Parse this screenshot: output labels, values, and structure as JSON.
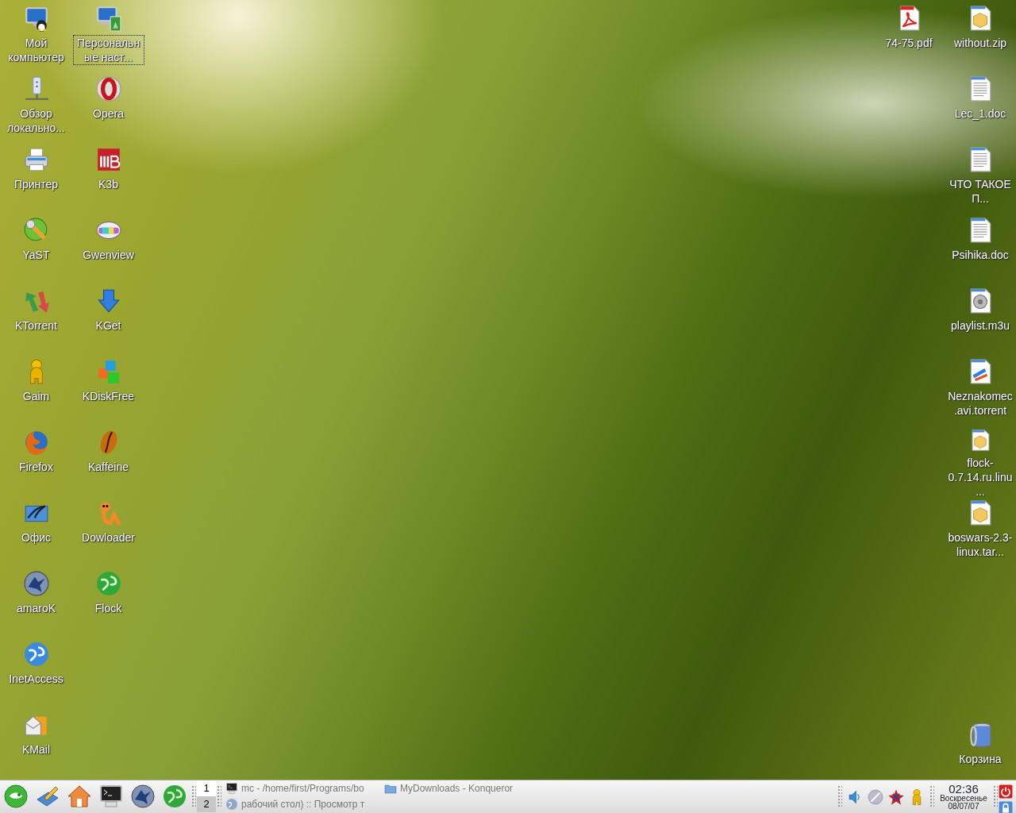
{
  "desktop": {
    "left_columns": [
      {
        "icons": [
          {
            "kind": "computer",
            "label": "Мой компьютер",
            "selected": false
          },
          {
            "kind": "network",
            "label": "Обзор локально...",
            "selected": false
          },
          {
            "kind": "printer",
            "label": "Принтер",
            "selected": false
          },
          {
            "kind": "wrench",
            "label": "YaST",
            "selected": false
          },
          {
            "kind": "arrows",
            "label": "KTorrent",
            "selected": false
          },
          {
            "kind": "person",
            "label": "Gaim",
            "selected": false
          },
          {
            "kind": "fox",
            "label": "Firefox",
            "selected": false
          },
          {
            "kind": "birds",
            "label": "Офис",
            "selected": false
          },
          {
            "kind": "wolf",
            "label": "amaroK",
            "selected": false
          },
          {
            "kind": "blueglobe",
            "label": "InetAccess",
            "selected": false
          },
          {
            "kind": "mail",
            "label": "KMail",
            "selected": false
          }
        ]
      },
      {
        "icons": [
          {
            "kind": "settings",
            "label": "Персональные наст...",
            "selected": true
          },
          {
            "kind": "opera",
            "label": "Opera",
            "selected": false
          },
          {
            "kind": "k3b",
            "label": "K3b",
            "selected": false
          },
          {
            "kind": "lens",
            "label": "Gwenview",
            "selected": false
          },
          {
            "kind": "download",
            "label": "KGet",
            "selected": false
          },
          {
            "kind": "cubes",
            "label": "KDiskFree",
            "selected": false
          },
          {
            "kind": "bean",
            "label": "Kaffeine",
            "selected": false
          },
          {
            "kind": "worm",
            "label": "Dowloader",
            "selected": false
          },
          {
            "kind": "greenglobe",
            "label": "Flock",
            "selected": false
          }
        ]
      }
    ],
    "right_columns": [
      {
        "icons": [
          {
            "kind": "pdf",
            "label": "74-75.pdf",
            "selected": false
          }
        ]
      },
      {
        "icons": [
          {
            "kind": "archive",
            "label": "without.zip",
            "selected": false
          },
          {
            "kind": "document",
            "label": "Lec_1.doc",
            "selected": false
          },
          {
            "kind": "document",
            "label": "ЧТО ТАКОЕ П...",
            "selected": false
          },
          {
            "kind": "document",
            "label": "Psihika.doc",
            "selected": false
          },
          {
            "kind": "audio",
            "label": "playlist.m3u",
            "selected": false
          },
          {
            "kind": "torrentfile",
            "label": "Neznakomec.avi.torrent",
            "selected": false
          },
          {
            "kind": "archive",
            "label": "flock-0.7.14.ru.linu...",
            "selected": false
          },
          {
            "kind": "archive",
            "label": "boswars-2.3-linux.tar...",
            "selected": false
          }
        ]
      }
    ],
    "trash": {
      "kind": "trash",
      "label": "Корзина",
      "selected": false
    }
  },
  "taskbar": {
    "launchers": [
      {
        "kind": "gecko"
      },
      {
        "kind": "pencil"
      },
      {
        "kind": "home"
      },
      {
        "kind": "terminal"
      },
      {
        "kind": "wolf"
      },
      {
        "kind": "greenglobe"
      }
    ],
    "pager": [
      {
        "label": "1",
        "selected": false
      },
      {
        "label": "2",
        "selected": true
      }
    ],
    "tasks": [
      {
        "kind": "terminal",
        "title": "mc - /home/first/Programs/bo"
      },
      {
        "kind": "folder",
        "title": "MyDownloads - Konqueror"
      },
      {
        "kind": "globe",
        "title": "рабочий стол) :: Просмотр т"
      }
    ],
    "tray": [
      {
        "kind": "speaker"
      },
      {
        "kind": "dish"
      },
      {
        "kind": "star"
      },
      {
        "kind": "person"
      }
    ],
    "clock": {
      "time": "02:36",
      "day": "Воскресенье",
      "date": "08/07/07"
    },
    "session_buttons": [
      {
        "kind": "logout"
      },
      {
        "kind": "lock"
      }
    ]
  }
}
